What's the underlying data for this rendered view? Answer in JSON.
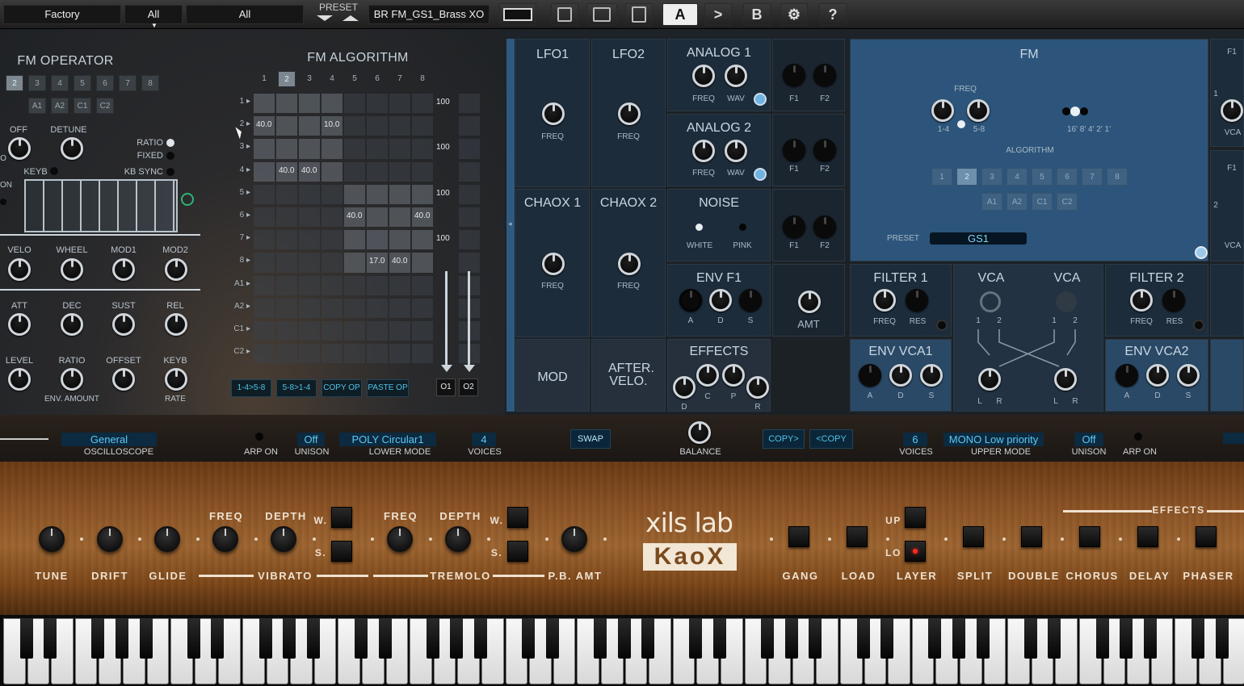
{
  "topbar": {
    "bank": "Factory",
    "category1": "All",
    "category2": "All",
    "preset_label": "PRESET",
    "preset_name": "BR FM_GS1_Brass XO",
    "btn_a": "A",
    "btn_arrow": ">",
    "btn_b": "B",
    "btn_help": "?"
  },
  "fm_operator": {
    "title": "FM OPERATOR",
    "ops": [
      "2",
      "3",
      "4",
      "5",
      "6",
      "7",
      "8"
    ],
    "ops_alt": [
      "A1",
      "A2",
      "C1",
      "C2"
    ],
    "selected": "2",
    "off": "OFF",
    "detune": "DETUNE",
    "ratio": "RATIO",
    "fixed": "FIXED",
    "keyb": "KEYB",
    "kb_sync": "KB SYNC",
    "on": "ON",
    "o_label": "O",
    "velo": "VELO",
    "wheel": "WHEEL",
    "mod1": "MOD1",
    "mod2": "MOD2",
    "att": "ATT",
    "dec": "DEC",
    "sust": "SUST",
    "rel": "REL",
    "level": "LEVEL",
    "ratio2": "RATIO",
    "offset": "OFFSET",
    "keyb2": "KEYB",
    "env_amount": "ENV. AMOUNT",
    "rate": "RATE"
  },
  "fm_algorithm": {
    "title": "FM ALGORITHM",
    "columns": [
      "1",
      "2",
      "3",
      "4",
      "5",
      "6",
      "7",
      "8"
    ],
    "selected_column": "2",
    "rows": [
      "1",
      "2",
      "3",
      "4",
      "5",
      "6",
      "7",
      "8",
      "A1",
      "A2",
      "C1",
      "C2"
    ],
    "cells": [
      {
        "row": "2",
        "col": 1,
        "value": "40.0"
      },
      {
        "row": "2",
        "col": 4,
        "value": "10.0"
      },
      {
        "row": "4",
        "col": 2,
        "value": "40.0"
      },
      {
        "row": "4",
        "col": 3,
        "value": "40.0"
      },
      {
        "row": "6",
        "col": 5,
        "value": "40.0"
      },
      {
        "row": "6",
        "col": 8,
        "value": "40.0"
      },
      {
        "row": "8",
        "col": 6,
        "value": "17.0"
      },
      {
        "row": "8",
        "col": 7,
        "value": "40.0"
      }
    ],
    "outputs": [
      {
        "row": "1",
        "value": "100"
      },
      {
        "row": "3",
        "value": "100"
      },
      {
        "row": "5",
        "value": "100"
      },
      {
        "row": "7",
        "value": "100"
      }
    ],
    "buttons": [
      "1-4>5-8",
      "5-8>1-4",
      "COPY OP",
      "PASTE OP"
    ],
    "out1": "O1",
    "out2": "O2"
  },
  "modules": {
    "lfo1": "LFO1",
    "lfo2": "LFO2",
    "chaox1": "CHAOX 1",
    "chaox2": "CHAOX 2",
    "freq": "FREQ",
    "analog1": "ANALOG 1",
    "analog2": "ANALOG 2",
    "wav": "WAV",
    "noise": "NOISE",
    "white": "WHITE",
    "pink": "PINK",
    "f1": "F1",
    "f2": "F2",
    "mod": "MOD",
    "after_velo": "AFTER. VELO.",
    "env_f1": "ENV F1",
    "a": "A",
    "d": "D",
    "s": "S",
    "r": "R",
    "c": "C",
    "p": "P",
    "amt": "AMT",
    "effects": "EFFECTS",
    "fm": "FM",
    "fm_freq": "FREQ",
    "range1": "1-4",
    "range2": "5-8",
    "feet": "16' 8' 4' 2' 1'",
    "algorithm": "ALGORITHM",
    "algo_buttons": [
      "1",
      "2",
      "3",
      "4",
      "5",
      "6",
      "7",
      "8"
    ],
    "algo_selected": "2",
    "algo_alt": [
      "A1",
      "A2",
      "C1",
      "C2"
    ],
    "preset": "PRESET",
    "preset_value": "GS1",
    "filter1": "FILTER 1",
    "filter2": "FILTER 2",
    "res": "RES",
    "vca": "VCA",
    "vca_b": "VCA",
    "one": "1",
    "two": "2",
    "l": "L",
    "r2": "R",
    "env_vca1": "ENV VCA1",
    "env_vca2": "ENV VCA2",
    "edge_f1": "F1",
    "edge_vca": "VCA",
    "edge_f1b": "F1",
    "edge_vca2": "VCA",
    "edge_1": "1",
    "edge_2": "2"
  },
  "infobar": {
    "oscilloscope_value": "General",
    "oscilloscope_label": "OSCILLOSCOPE",
    "arp_on_label": "ARP ON",
    "unison_value": "Off",
    "unison_label": "UNISON",
    "lower_mode_value": "POLY Circular1",
    "lower_mode_label": "LOWER MODE",
    "voices_value": "4",
    "voices_label": "VOICES",
    "swap": "SWAP",
    "balance": "BALANCE",
    "copy_right": "COPY>",
    "copy_left": "<COPY",
    "upper_voices_value": "6",
    "upper_voices_label": "VOICES",
    "upper_mode_value": "MONO Low priority",
    "upper_mode_label": "UPPER MODE",
    "upper_unison_value": "Off",
    "upper_unison_label": "UNISON",
    "upper_arp_label": "ARP ON"
  },
  "woodpanel": {
    "tune": "TUNE",
    "drift": "DRIFT",
    "glide": "GLIDE",
    "vibrato": "VIBRATO",
    "freq": "FREQ",
    "depth": "DEPTH",
    "w": "W.",
    "s": "S.",
    "tremolo": "TREMOLO",
    "freq2": "FREQ",
    "depth2": "DEPTH",
    "w2": "W.",
    "s2": "S.",
    "pb_amt": "P.B. AMT",
    "brand": "xils lab",
    "product": "KaoX",
    "up": "UP",
    "lo": "LO",
    "gang": "GANG",
    "load": "LOAD",
    "layer": "LAYER",
    "split": "SPLIT",
    "double": "DOUBLE",
    "chorus": "CHORUS",
    "delay": "DELAY",
    "phaser": "PHASER",
    "effects": "EFFECTS"
  },
  "colors": {
    "accent_blue": "#4fc3e6",
    "fm_panel": "#2c4f72",
    "wood": "#8a5224",
    "led_red": "#ff2a1a"
  }
}
